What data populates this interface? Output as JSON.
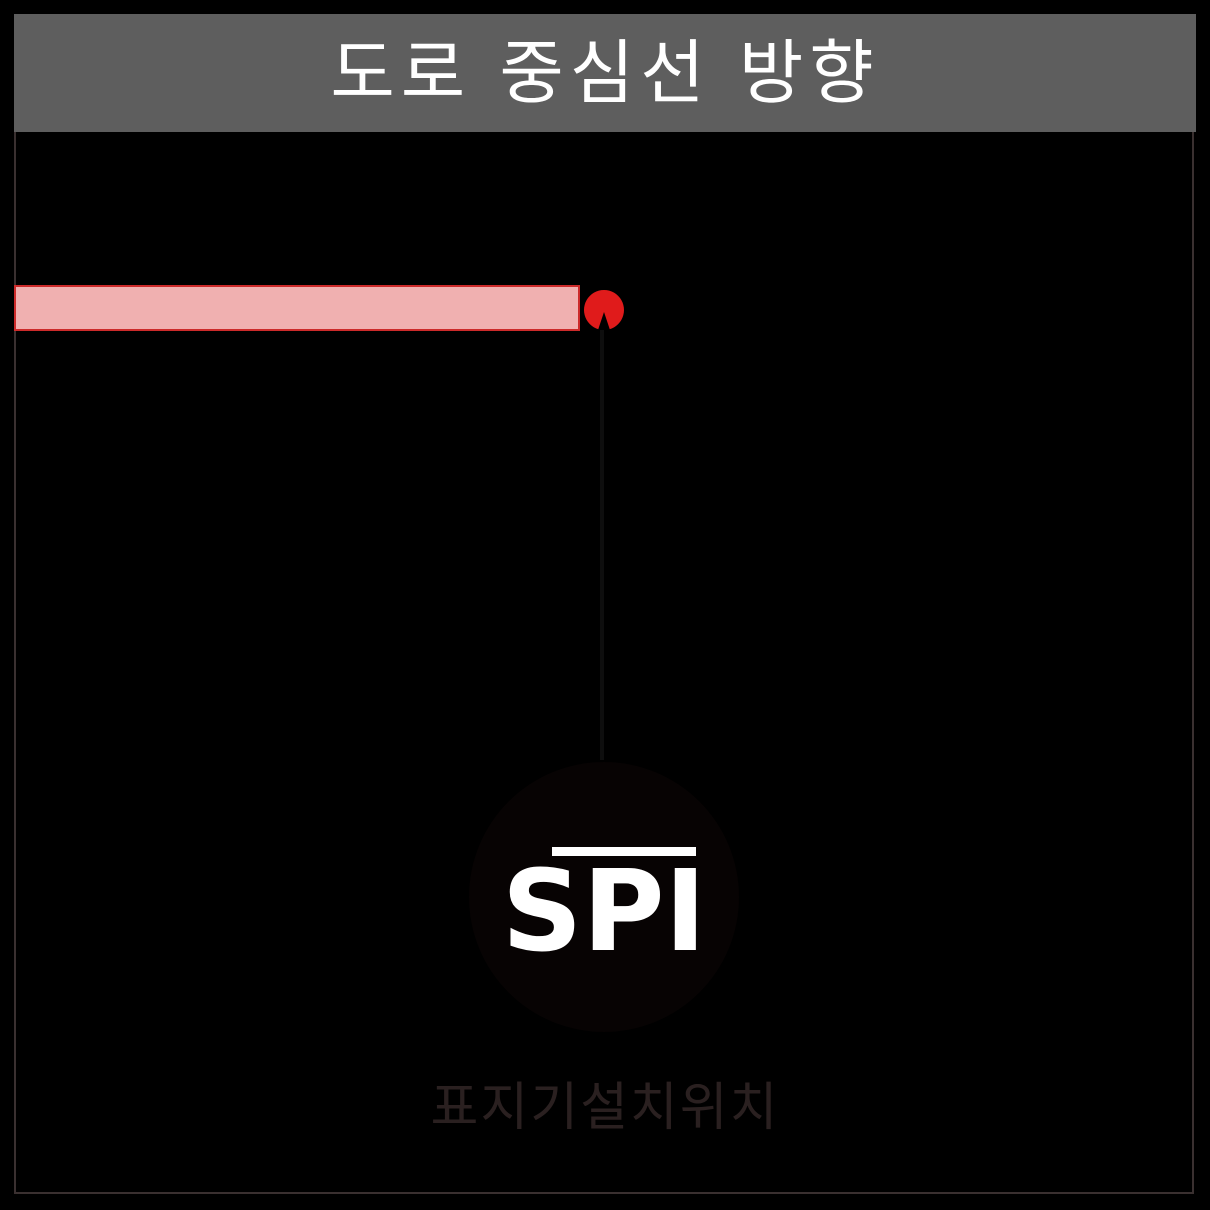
{
  "header": {
    "title": "도로 중심선 방향"
  },
  "diagram": {
    "logo_text": "SPI",
    "caption": "표지기설치위치"
  },
  "colors": {
    "header_bg": "#5e5e5e",
    "background": "#000000",
    "road_fill": "#f0b0b0",
    "road_stroke": "#cc2a2a",
    "marker": "#e01b1b",
    "caption": "#2a2020"
  },
  "icons": {
    "marker": "location-marker-icon",
    "logo": "spi-logo"
  }
}
